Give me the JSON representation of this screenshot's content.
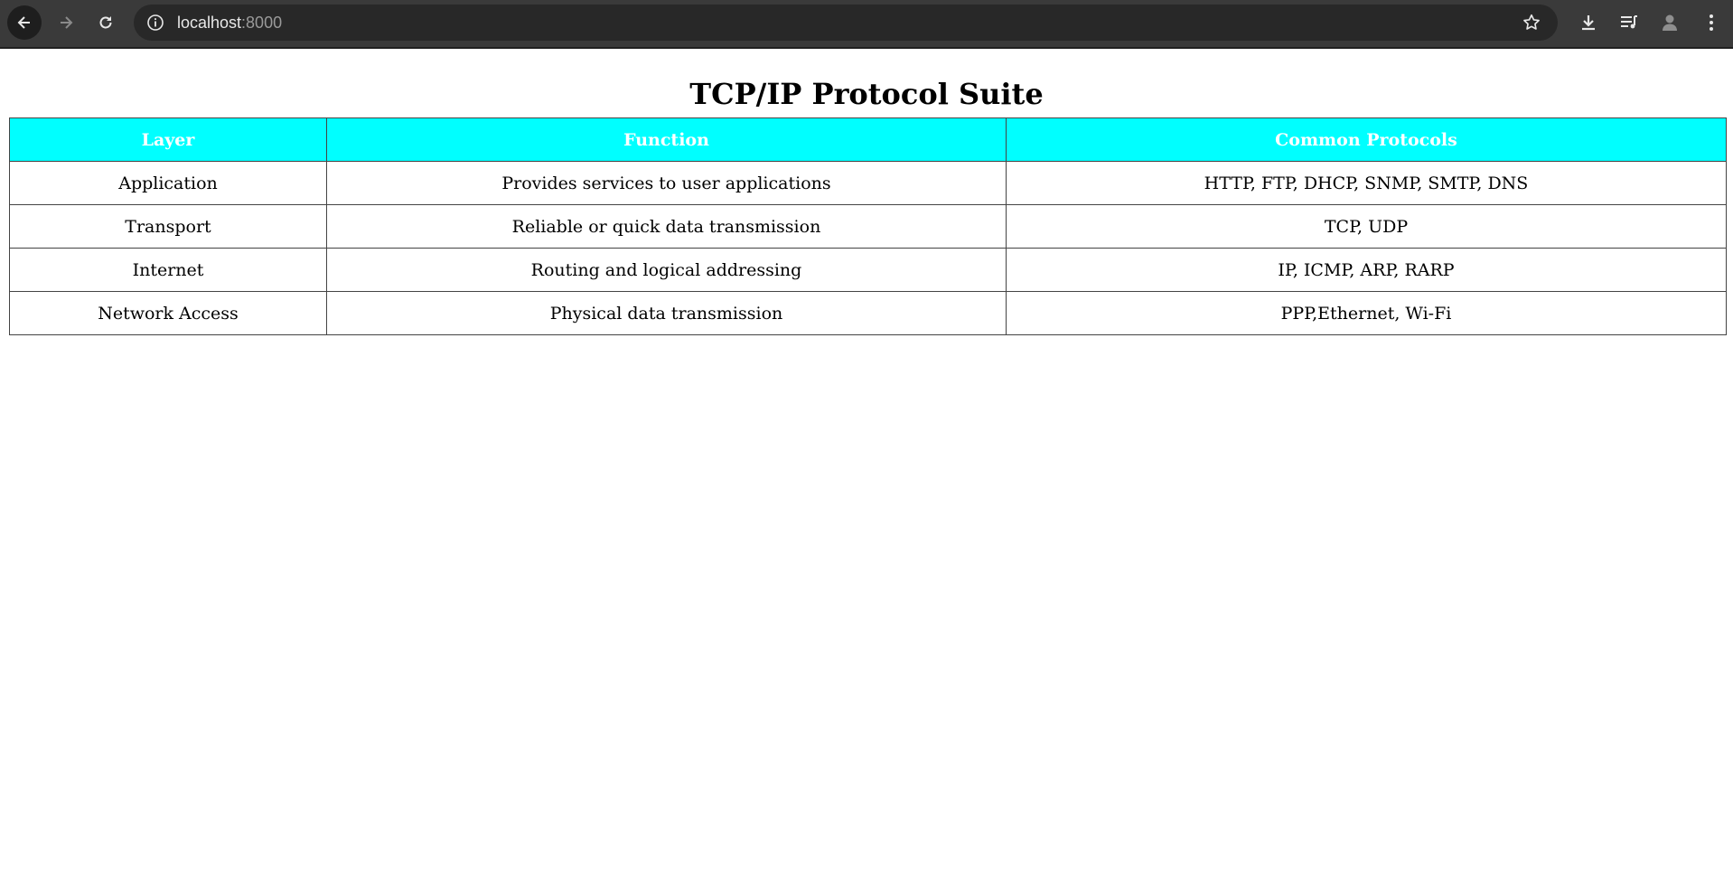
{
  "browser": {
    "url_host": "localhost",
    "url_port": ":8000",
    "icons": {
      "back": "back-arrow-icon",
      "forward": "forward-arrow-icon",
      "reload": "reload-icon",
      "info": "info-icon",
      "bookmark": "star-icon",
      "downloads": "download-icon",
      "media": "media-queue-icon",
      "profile": "avatar-icon",
      "menu": "kebab-menu-icon"
    }
  },
  "page": {
    "title": "TCP/IP Protocol Suite",
    "table": {
      "header_color": "#00ffff",
      "headers": [
        "Layer",
        "Function",
        "Common Protocols"
      ],
      "rows": [
        [
          "Application",
          "Provides services to user applications",
          "HTTP, FTP, DHCP, SNMP, SMTP, DNS"
        ],
        [
          "Transport",
          "Reliable or quick data transmission",
          "TCP, UDP"
        ],
        [
          "Internet",
          "Routing and logical addressing",
          "IP, ICMP, ARP, RARP"
        ],
        [
          "Network Access",
          "Physical data transmission",
          "PPP,Ethernet, Wi-Fi"
        ]
      ]
    }
  }
}
